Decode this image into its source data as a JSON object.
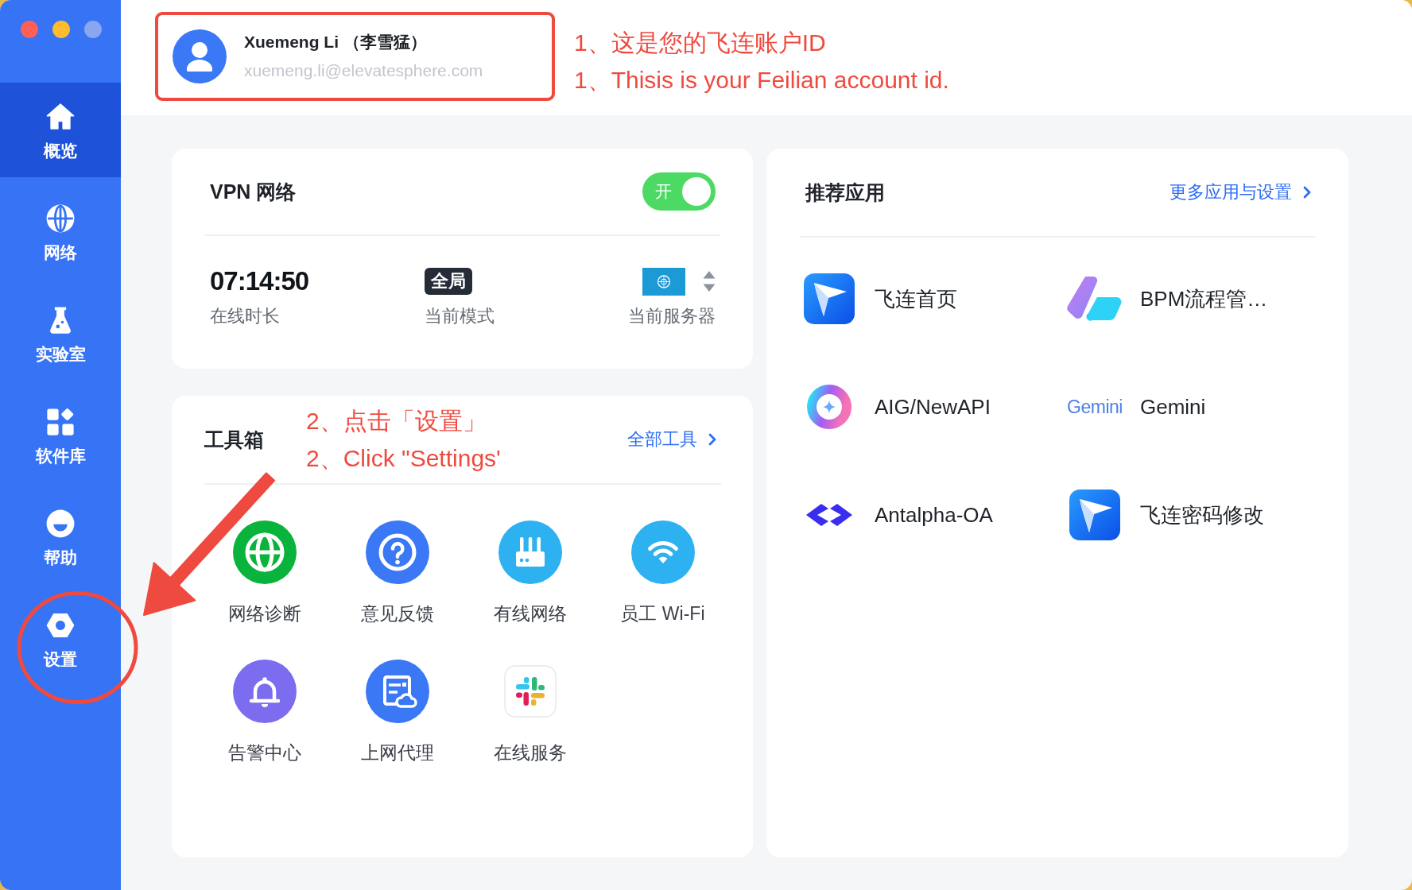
{
  "sidebar": {
    "items": [
      {
        "label": "概览",
        "selected": true,
        "circled": false
      },
      {
        "label": "网络",
        "selected": false,
        "circled": false
      },
      {
        "label": "实验室",
        "selected": false,
        "circled": false
      },
      {
        "label": "软件库",
        "selected": false,
        "circled": false
      },
      {
        "label": "帮助",
        "selected": false,
        "circled": false
      },
      {
        "label": "设置",
        "selected": false,
        "circled": true
      }
    ]
  },
  "account": {
    "name": "Xuemeng Li （李雪猛）",
    "email": "xuemeng.li@elevatesphere.com",
    "highlighted": true
  },
  "account_note": {
    "lines": [
      "1、这是您的飞连账户ID",
      "1、Thisis is your Feilian account id."
    ]
  },
  "vpn": {
    "title": "VPN 网络",
    "toggle": {
      "label": "开",
      "on": true
    },
    "stats": [
      {
        "kind": "duration",
        "value": "07:14:50",
        "label": "在线时长"
      },
      {
        "kind": "mode",
        "value": "全局",
        "label": "当前模式"
      },
      {
        "kind": "server",
        "label": "当前服务器"
      }
    ]
  },
  "toolbox": {
    "title": "工具箱",
    "note": {
      "lines": [
        "2、点击「设置」",
        "2、Click \"Settings'"
      ]
    },
    "link": "全部工具",
    "tools": [
      {
        "label": "网络诊断"
      },
      {
        "label": "意见反馈"
      },
      {
        "label": "有线网络"
      },
      {
        "label": "员工 Wi-Fi"
      },
      {
        "label": "告警中心"
      },
      {
        "label": "上网代理"
      },
      {
        "label": "在线服务"
      }
    ]
  },
  "apps": {
    "title": "推荐应用",
    "link": "更多应用与设置",
    "items": [
      {
        "name": "飞连首页"
      },
      {
        "name": "BPM流程管…"
      },
      {
        "name": "AIG/NewAPI"
      },
      {
        "name": "Gemini",
        "logo_text": "Gemini"
      },
      {
        "name": "Antalpha-OA"
      },
      {
        "name": "飞连密码修改"
      }
    ]
  }
}
